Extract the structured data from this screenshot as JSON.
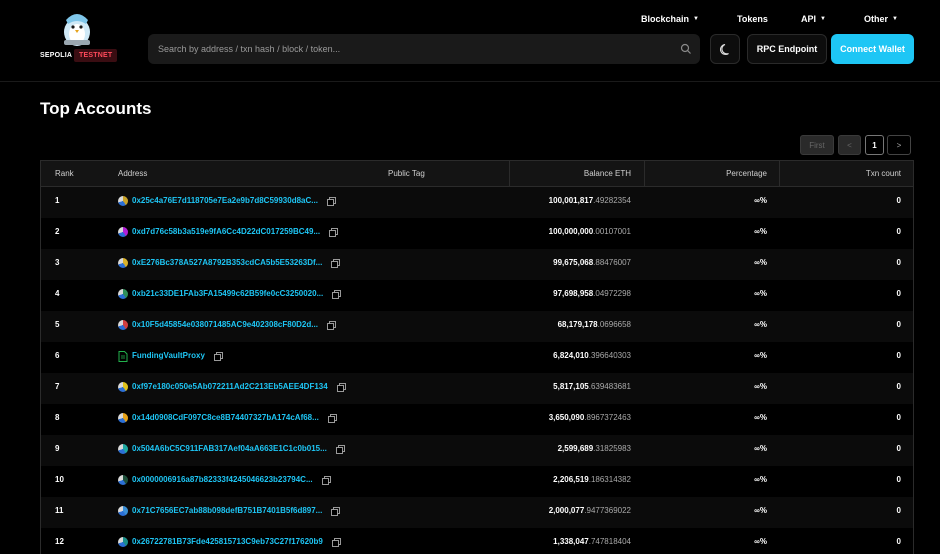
{
  "network": {
    "name": "SEPOLIA",
    "badge": "TESTNET"
  },
  "nav": {
    "blockchain": "Blockchain",
    "tokens": "Tokens",
    "api": "API",
    "other": "Other"
  },
  "search": {
    "placeholder": "Search by address / txn hash / block / token..."
  },
  "buttons": {
    "rpc": "RPC Endpoint",
    "connect": "Connect Wallet"
  },
  "page_title": "Top Accounts",
  "pagination": {
    "first": "First",
    "prev": "<",
    "current": "1",
    "next": ">"
  },
  "table": {
    "headers": {
      "rank": "Rank",
      "address": "Address",
      "public_tag": "Public Tag",
      "balance": "Balance ETH",
      "percentage": "Percentage",
      "txn_count": "Txn count"
    },
    "rows": [
      {
        "rank": "1",
        "address": "0x25c4a76E7d118705e7Ea2e9b7d8C59930d8aC...",
        "bal_int": "100,001,817",
        "bal_dec": ".49282354",
        "pct": "∞%",
        "txn": "0",
        "avatar_color": "#c9a227",
        "icon": "avatar"
      },
      {
        "rank": "2",
        "address": "0xd7d76c58b3a519e9fA6Cc4D22dC017259BC49...",
        "bal_int": "100,000,000",
        "bal_dec": ".00107001",
        "pct": "∞%",
        "txn": "0",
        "avatar_color": "#b21fd6",
        "icon": "avatar"
      },
      {
        "rank": "3",
        "address": "0xE276Bc378A527A8792B353cdCA5b5E53263Df...",
        "bal_int": "99,675,068",
        "bal_dec": ".88476007",
        "pct": "∞%",
        "txn": "0",
        "avatar_color": "#d9b12a",
        "icon": "avatar"
      },
      {
        "rank": "4",
        "address": "0xb21c33DE1FAb3FA15499c62B59fe0cC3250020...",
        "bal_int": "97,698,958",
        "bal_dec": ".04972298",
        "pct": "∞%",
        "txn": "0",
        "avatar_color": "#2f8f5a",
        "icon": "avatar"
      },
      {
        "rank": "5",
        "address": "0x10F5d45854e038071485AC9e402308cF80D2d...",
        "bal_int": "68,179,178",
        "bal_dec": ".0696658",
        "pct": "∞%",
        "txn": "0",
        "avatar_color": "#d13f3f",
        "icon": "avatar"
      },
      {
        "rank": "6",
        "address": "FundingVaultProxy",
        "bal_int": "6,824,010",
        "bal_dec": ".396640303",
        "pct": "∞%",
        "txn": "0",
        "avatar_color": "#22b14c",
        "icon": "file"
      },
      {
        "rank": "7",
        "address": "0xf97e180c050e5Ab072211Ad2C213Eb5AEE4DF134",
        "bal_int": "5,817,105",
        "bal_dec": ".639483681",
        "pct": "∞%",
        "txn": "0",
        "avatar_color": "#e0c21a",
        "icon": "avatar"
      },
      {
        "rank": "8",
        "address": "0x14d0908CdF097C8ce8B74407327bA174cAf68...",
        "bal_int": "3,650,090",
        "bal_dec": ".8967372463",
        "pct": "∞%",
        "txn": "0",
        "avatar_color": "#e6a21a",
        "icon": "avatar"
      },
      {
        "rank": "9",
        "address": "0x504A6bC5C911FAB317Aef04aA663E1C1c0b015...",
        "bal_int": "2,599,689",
        "bal_dec": ".31825983",
        "pct": "∞%",
        "txn": "0",
        "avatar_color": "#1fa7a0",
        "icon": "avatar"
      },
      {
        "rank": "10",
        "address": "0x0000006916a87b82333f4245046623b23794C...",
        "bal_int": "2,206,519",
        "bal_dec": ".186314382",
        "pct": "∞%",
        "txn": "0",
        "avatar_color": "#1d4f3a",
        "icon": "avatar"
      },
      {
        "rank": "11",
        "address": "0x71C7656EC7ab88b098defB751B7401B5f6d897...",
        "bal_int": "2,000,077",
        "bal_dec": ".9477369022",
        "pct": "∞%",
        "txn": "0",
        "avatar_color": "#3a8fd6",
        "icon": "avatar"
      },
      {
        "rank": "12",
        "address": "0x26722781B73Fde425815713C9eb73C27f17620b9",
        "bal_int": "1,338,047",
        "bal_dec": ".747818404",
        "pct": "∞%",
        "txn": "0",
        "avatar_color": "#1a8f8a",
        "icon": "avatar"
      }
    ]
  }
}
